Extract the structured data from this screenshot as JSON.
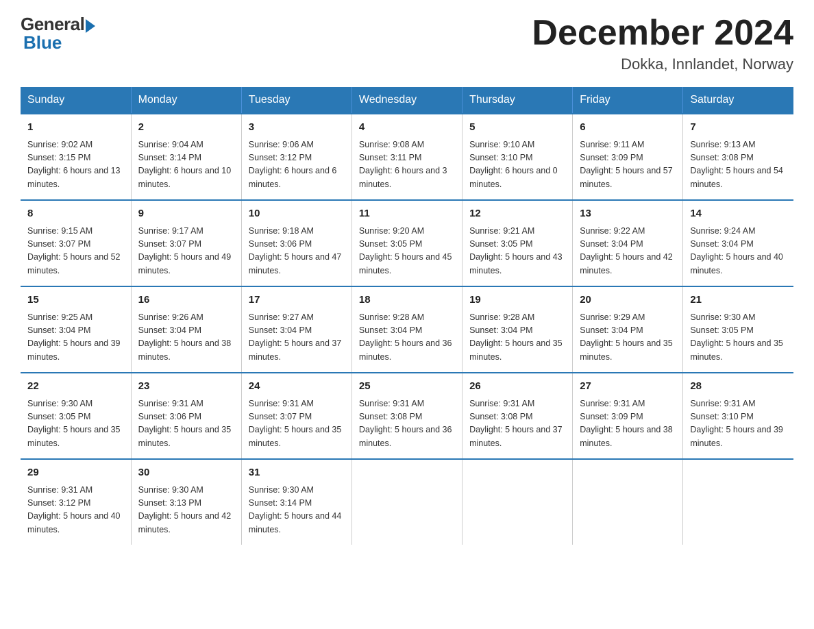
{
  "logo": {
    "general": "General",
    "blue": "Blue"
  },
  "title": "December 2024",
  "location": "Dokka, Innlandet, Norway",
  "days_of_week": [
    "Sunday",
    "Monday",
    "Tuesday",
    "Wednesday",
    "Thursday",
    "Friday",
    "Saturday"
  ],
  "weeks": [
    [
      {
        "day": "1",
        "sunrise": "9:02 AM",
        "sunset": "3:15 PM",
        "daylight": "6 hours and 13 minutes."
      },
      {
        "day": "2",
        "sunrise": "9:04 AM",
        "sunset": "3:14 PM",
        "daylight": "6 hours and 10 minutes."
      },
      {
        "day": "3",
        "sunrise": "9:06 AM",
        "sunset": "3:12 PM",
        "daylight": "6 hours and 6 minutes."
      },
      {
        "day": "4",
        "sunrise": "9:08 AM",
        "sunset": "3:11 PM",
        "daylight": "6 hours and 3 minutes."
      },
      {
        "day": "5",
        "sunrise": "9:10 AM",
        "sunset": "3:10 PM",
        "daylight": "6 hours and 0 minutes."
      },
      {
        "day": "6",
        "sunrise": "9:11 AM",
        "sunset": "3:09 PM",
        "daylight": "5 hours and 57 minutes."
      },
      {
        "day": "7",
        "sunrise": "9:13 AM",
        "sunset": "3:08 PM",
        "daylight": "5 hours and 54 minutes."
      }
    ],
    [
      {
        "day": "8",
        "sunrise": "9:15 AM",
        "sunset": "3:07 PM",
        "daylight": "5 hours and 52 minutes."
      },
      {
        "day": "9",
        "sunrise": "9:17 AM",
        "sunset": "3:07 PM",
        "daylight": "5 hours and 49 minutes."
      },
      {
        "day": "10",
        "sunrise": "9:18 AM",
        "sunset": "3:06 PM",
        "daylight": "5 hours and 47 minutes."
      },
      {
        "day": "11",
        "sunrise": "9:20 AM",
        "sunset": "3:05 PM",
        "daylight": "5 hours and 45 minutes."
      },
      {
        "day": "12",
        "sunrise": "9:21 AM",
        "sunset": "3:05 PM",
        "daylight": "5 hours and 43 minutes."
      },
      {
        "day": "13",
        "sunrise": "9:22 AM",
        "sunset": "3:04 PM",
        "daylight": "5 hours and 42 minutes."
      },
      {
        "day": "14",
        "sunrise": "9:24 AM",
        "sunset": "3:04 PM",
        "daylight": "5 hours and 40 minutes."
      }
    ],
    [
      {
        "day": "15",
        "sunrise": "9:25 AM",
        "sunset": "3:04 PM",
        "daylight": "5 hours and 39 minutes."
      },
      {
        "day": "16",
        "sunrise": "9:26 AM",
        "sunset": "3:04 PM",
        "daylight": "5 hours and 38 minutes."
      },
      {
        "day": "17",
        "sunrise": "9:27 AM",
        "sunset": "3:04 PM",
        "daylight": "5 hours and 37 minutes."
      },
      {
        "day": "18",
        "sunrise": "9:28 AM",
        "sunset": "3:04 PM",
        "daylight": "5 hours and 36 minutes."
      },
      {
        "day": "19",
        "sunrise": "9:28 AM",
        "sunset": "3:04 PM",
        "daylight": "5 hours and 35 minutes."
      },
      {
        "day": "20",
        "sunrise": "9:29 AM",
        "sunset": "3:04 PM",
        "daylight": "5 hours and 35 minutes."
      },
      {
        "day": "21",
        "sunrise": "9:30 AM",
        "sunset": "3:05 PM",
        "daylight": "5 hours and 35 minutes."
      }
    ],
    [
      {
        "day": "22",
        "sunrise": "9:30 AM",
        "sunset": "3:05 PM",
        "daylight": "5 hours and 35 minutes."
      },
      {
        "day": "23",
        "sunrise": "9:31 AM",
        "sunset": "3:06 PM",
        "daylight": "5 hours and 35 minutes."
      },
      {
        "day": "24",
        "sunrise": "9:31 AM",
        "sunset": "3:07 PM",
        "daylight": "5 hours and 35 minutes."
      },
      {
        "day": "25",
        "sunrise": "9:31 AM",
        "sunset": "3:08 PM",
        "daylight": "5 hours and 36 minutes."
      },
      {
        "day": "26",
        "sunrise": "9:31 AM",
        "sunset": "3:08 PM",
        "daylight": "5 hours and 37 minutes."
      },
      {
        "day": "27",
        "sunrise": "9:31 AM",
        "sunset": "3:09 PM",
        "daylight": "5 hours and 38 minutes."
      },
      {
        "day": "28",
        "sunrise": "9:31 AM",
        "sunset": "3:10 PM",
        "daylight": "5 hours and 39 minutes."
      }
    ],
    [
      {
        "day": "29",
        "sunrise": "9:31 AM",
        "sunset": "3:12 PM",
        "daylight": "5 hours and 40 minutes."
      },
      {
        "day": "30",
        "sunrise": "9:30 AM",
        "sunset": "3:13 PM",
        "daylight": "5 hours and 42 minutes."
      },
      {
        "day": "31",
        "sunrise": "9:30 AM",
        "sunset": "3:14 PM",
        "daylight": "5 hours and 44 minutes."
      },
      {
        "day": "",
        "sunrise": "",
        "sunset": "",
        "daylight": ""
      },
      {
        "day": "",
        "sunrise": "",
        "sunset": "",
        "daylight": ""
      },
      {
        "day": "",
        "sunrise": "",
        "sunset": "",
        "daylight": ""
      },
      {
        "day": "",
        "sunrise": "",
        "sunset": "",
        "daylight": ""
      }
    ]
  ],
  "labels": {
    "sunrise": "Sunrise:",
    "sunset": "Sunset:",
    "daylight": "Daylight:"
  }
}
